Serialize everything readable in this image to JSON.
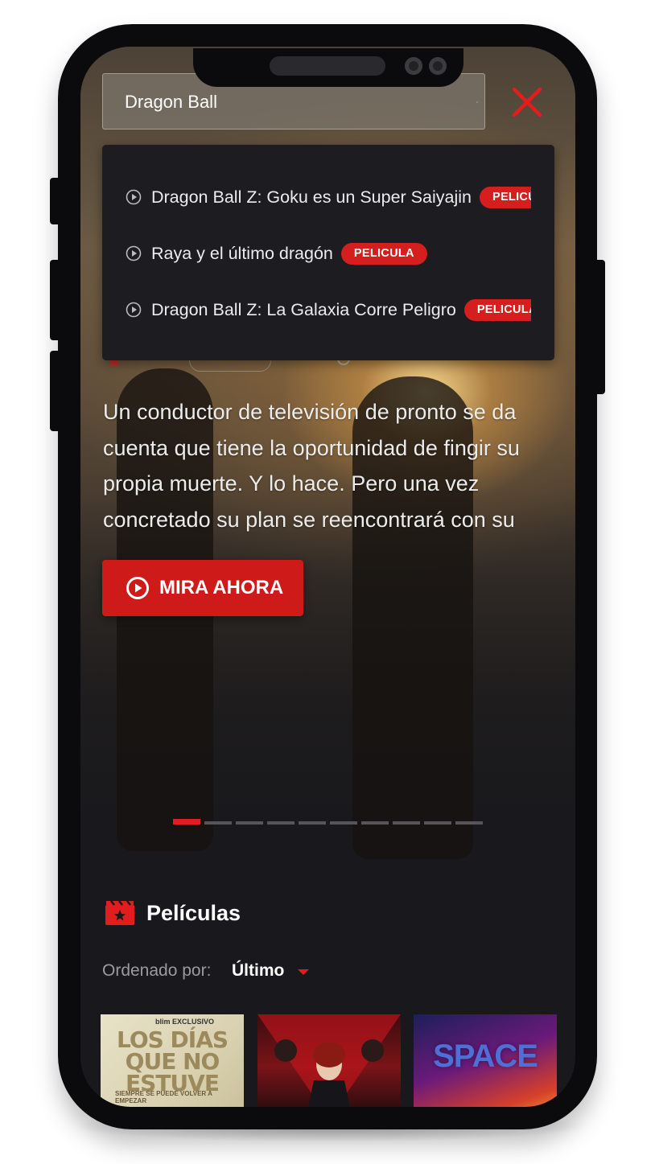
{
  "search": {
    "value": "Dragon Ball"
  },
  "suggestions": [
    {
      "title": "Dragon Ball Z: Goku es un Super Saiyajin",
      "badge": "PELICULA"
    },
    {
      "title": "Raya y el último dragón",
      "badge": "PELICULA"
    },
    {
      "title": "Dragon Ball Z: La Galaxia Corre Peligro",
      "badge": "PELICULA"
    }
  ],
  "hero": {
    "description": "Un conductor de televisión de pronto se da cuenta que tiene la oportunidad de fingir su propia muerte. Y lo hace. Pero una vez concretado su plan se reencontrará con su",
    "watch_label": "MIRA AHORA",
    "slide_count": 10,
    "active_slide": 1
  },
  "section": {
    "title": "Películas",
    "sort_label": "Ordenado por:",
    "sort_value": "Último"
  },
  "posters": [
    {
      "brand": "blim EXCLUSIVO",
      "title": "LOS DÍAS QUE NO ESTUVE",
      "tagline": "SIEMPRE SE PUEDE VOLVER A EMPEZAR"
    },
    {
      "title": ""
    },
    {
      "title": "SPACE"
    }
  ],
  "colors": {
    "accent": "#e11d1d",
    "background": "#19191d",
    "dropdown": "#1c1c21"
  },
  "icons": {
    "close": "close-icon",
    "play": "play-circle-icon",
    "section": "clapperboard-icon",
    "caret": "caret-down-icon"
  }
}
